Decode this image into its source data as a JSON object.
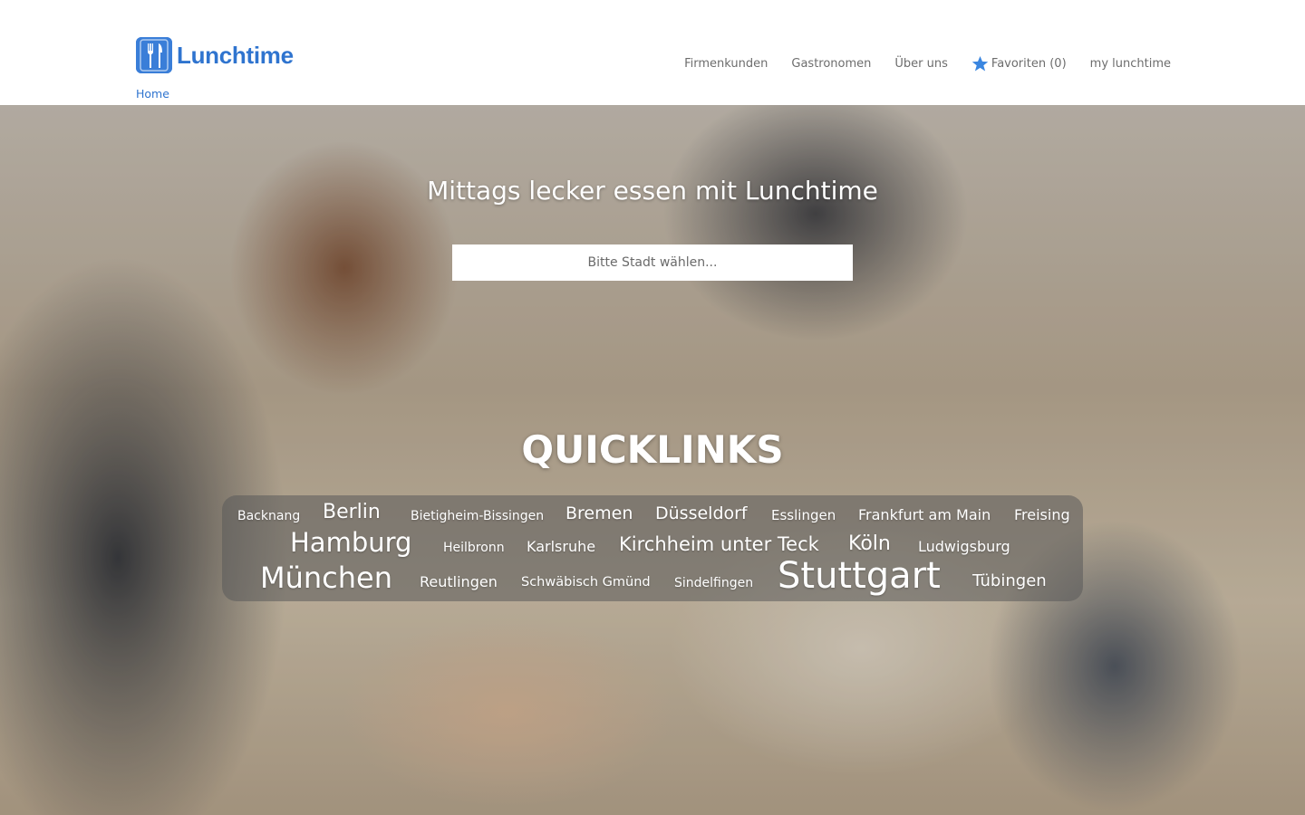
{
  "brand": {
    "name": "Lunchtime",
    "color": "#2f74cf"
  },
  "nav": {
    "items": [
      {
        "label": "Firmenkunden"
      },
      {
        "label": "Gastronomen"
      },
      {
        "label": "Über uns"
      },
      {
        "label": "Favoriten (0)",
        "icon": "star-icon"
      },
      {
        "label": "my lunchtime"
      }
    ]
  },
  "breadcrumb": {
    "home": "Home"
  },
  "hero": {
    "title": "Mittags lecker essen mit Lunchtime",
    "search_placeholder": "Bitte Stadt wählen..."
  },
  "quicklinks": {
    "title": "QUICKLINKS",
    "cities": [
      "Backnang",
      "Berlin",
      "Bietigheim-Bissingen",
      "Bremen",
      "Düsseldorf",
      "Esslingen",
      "Frankfurt am Main",
      "Freising",
      "Hamburg",
      "Heilbronn",
      "Karlsruhe",
      "Kirchheim unter Teck",
      "Köln",
      "Ludwigsburg",
      "München",
      "Reutlingen",
      "Schwäbisch Gmünd",
      "Sindelfingen",
      "Stuttgart",
      "Tübingen"
    ]
  }
}
